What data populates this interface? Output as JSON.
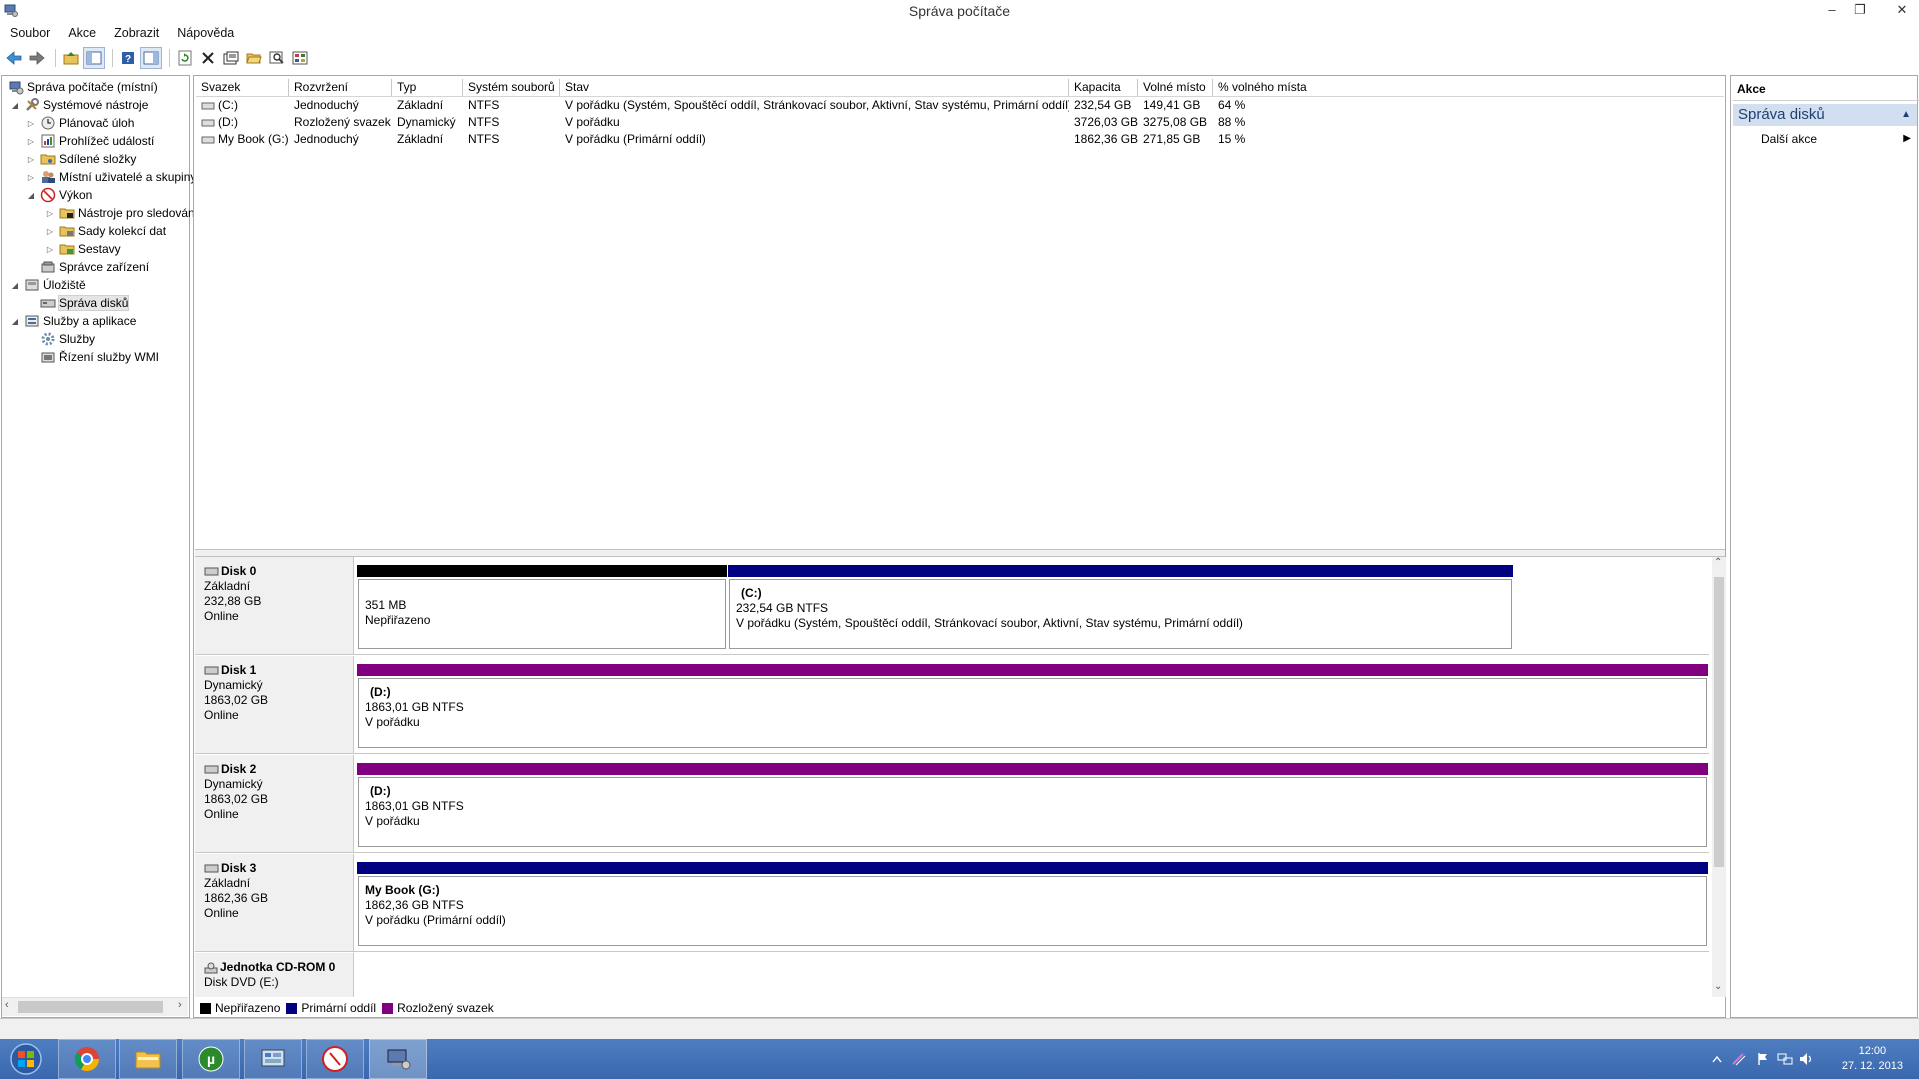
{
  "window": {
    "title": "Správa počítače",
    "buttons": {
      "minimize": "–",
      "restore": "❐",
      "close": "✕"
    }
  },
  "menu": [
    "Soubor",
    "Akce",
    "Zobrazit",
    "Nápověda"
  ],
  "toolbar_icons": [
    "back-arrow-icon",
    "forward-arrow-icon",
    "up-folder-icon",
    "show-hide-tree-icon",
    "help-icon",
    "console-tree-icon",
    "refresh-icon",
    "delete-icon",
    "properties-icon",
    "open-folder-icon",
    "search-icon",
    "settings-icon"
  ],
  "tree": {
    "root": "Správa počítače (místní)",
    "system_tools": "Systémové nástroje",
    "task_scheduler": "Plánovač úloh",
    "event_viewer": "Prohlížeč událostí",
    "shared_folders": "Sdílené složky",
    "local_users": "Místní uživatelé a skupiny",
    "performance": "Výkon",
    "monitoring_tools": "Nástroje pro sledování",
    "data_collector_sets": "Sady kolekcí dat",
    "reports": "Sestavy",
    "device_manager": "Správce zařízení",
    "storage": "Úložiště",
    "disk_management": "Správa disků",
    "services_apps": "Služby a aplikace",
    "services": "Služby",
    "wmi_control": "Řízení služby WMI"
  },
  "volume_list": {
    "columns": [
      "Svazek",
      "Rozvržení",
      "Typ",
      "Systém souborů",
      "Stav",
      "Kapacita",
      "Volné místo",
      "% volného místa"
    ],
    "rows": [
      [
        "(C:)",
        "Jednoduchý",
        "Základní",
        "NTFS",
        "V pořádku (Systém, Spouštěcí oddíl, Stránkovací soubor, Aktivní, Stav systému, Primární oddíl)",
        "232,54 GB",
        "149,41 GB",
        "64 %"
      ],
      [
        "(D:)",
        "Rozložený svazek",
        "Dynamický",
        "NTFS",
        "V pořádku",
        "3726,03 GB",
        "3275,08 GB",
        "88 %"
      ],
      [
        "My Book (G:)",
        "Jednoduchý",
        "Základní",
        "NTFS",
        "V pořádku (Primární oddíl)",
        "1862,36 GB",
        "271,85 GB",
        "15 %"
      ]
    ]
  },
  "disks": [
    {
      "name": "Disk 0",
      "type": "Základní",
      "size": "232,88 GB",
      "status": "Online",
      "partitions": [
        {
          "kind": "unallocated",
          "name": "",
          "line1": "351 MB",
          "line2": "Nepřiřazeno"
        },
        {
          "kind": "primary",
          "name": "(C:)",
          "line1": "232,54 GB NTFS",
          "line2": "V pořádku (Systém, Spouštěcí oddíl, Stránkovací soubor, Aktivní, Stav systému, Primární oddíl)"
        }
      ]
    },
    {
      "name": "Disk 1",
      "type": "Dynamický",
      "size": "1863,02 GB",
      "status": "Online",
      "partitions": [
        {
          "kind": "spanned",
          "name": "(D:)",
          "line1": "1863,01 GB NTFS",
          "line2": "V pořádku"
        }
      ]
    },
    {
      "name": "Disk 2",
      "type": "Dynamický",
      "size": "1863,02 GB",
      "status": "Online",
      "partitions": [
        {
          "kind": "spanned-selected",
          "name": "(D:)",
          "line1": "1863,01 GB NTFS",
          "line2": "V pořádku"
        }
      ]
    },
    {
      "name": "Disk 3",
      "type": "Základní",
      "size": "1862,36 GB",
      "status": "Online",
      "partitions": [
        {
          "kind": "primary",
          "name": "My Book  (G:)",
          "line1": "1862,36 GB NTFS",
          "line2": "V pořádku (Primární oddíl)"
        }
      ]
    }
  ],
  "cdrom": {
    "name": "Jednotka CD-ROM 0",
    "type": "Disk DVD (E:)"
  },
  "legend": [
    {
      "label": "Nepřiřazeno",
      "color": "#000000"
    },
    {
      "label": "Primární oddíl",
      "color": "#000080"
    },
    {
      "label": "Rozložený svazek",
      "color": "#800080"
    }
  ],
  "actions": {
    "header": "Akce",
    "group": "Správa disků",
    "more": "Další akce"
  },
  "taskbar": {
    "apps": [
      "chrome-icon",
      "file-explorer-icon",
      "utorrent-icon",
      "control-panel-icon",
      "speed-dial-icon",
      "computer-management-icon"
    ],
    "time": "12:00",
    "date": "27. 12. 2013"
  }
}
